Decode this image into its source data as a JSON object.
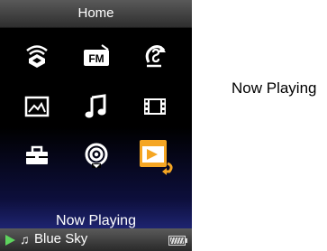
{
  "header": {
    "title": "Home"
  },
  "menu": {
    "items": [
      {
        "name": "wireless",
        "icon": "wireless-icon"
      },
      {
        "name": "fm",
        "icon": "fm-radio-icon",
        "label": "FM"
      },
      {
        "name": "sync",
        "icon": "sync-icon"
      },
      {
        "name": "photo",
        "icon": "photo-icon"
      },
      {
        "name": "music",
        "icon": "music-icon"
      },
      {
        "name": "video",
        "icon": "video-icon"
      },
      {
        "name": "settings",
        "icon": "toolbox-icon"
      },
      {
        "name": "podcast",
        "icon": "podcast-icon"
      },
      {
        "name": "now-playing",
        "icon": "now-playing-icon",
        "selected": true
      }
    ],
    "selected_caption": "Now Playing"
  },
  "status": {
    "track": "Blue Sky",
    "state": "playing",
    "battery_level": 1.0
  },
  "callout": {
    "label": "Now Playing"
  },
  "colors": {
    "accent": "#f5a623",
    "play": "#5ed45e"
  }
}
